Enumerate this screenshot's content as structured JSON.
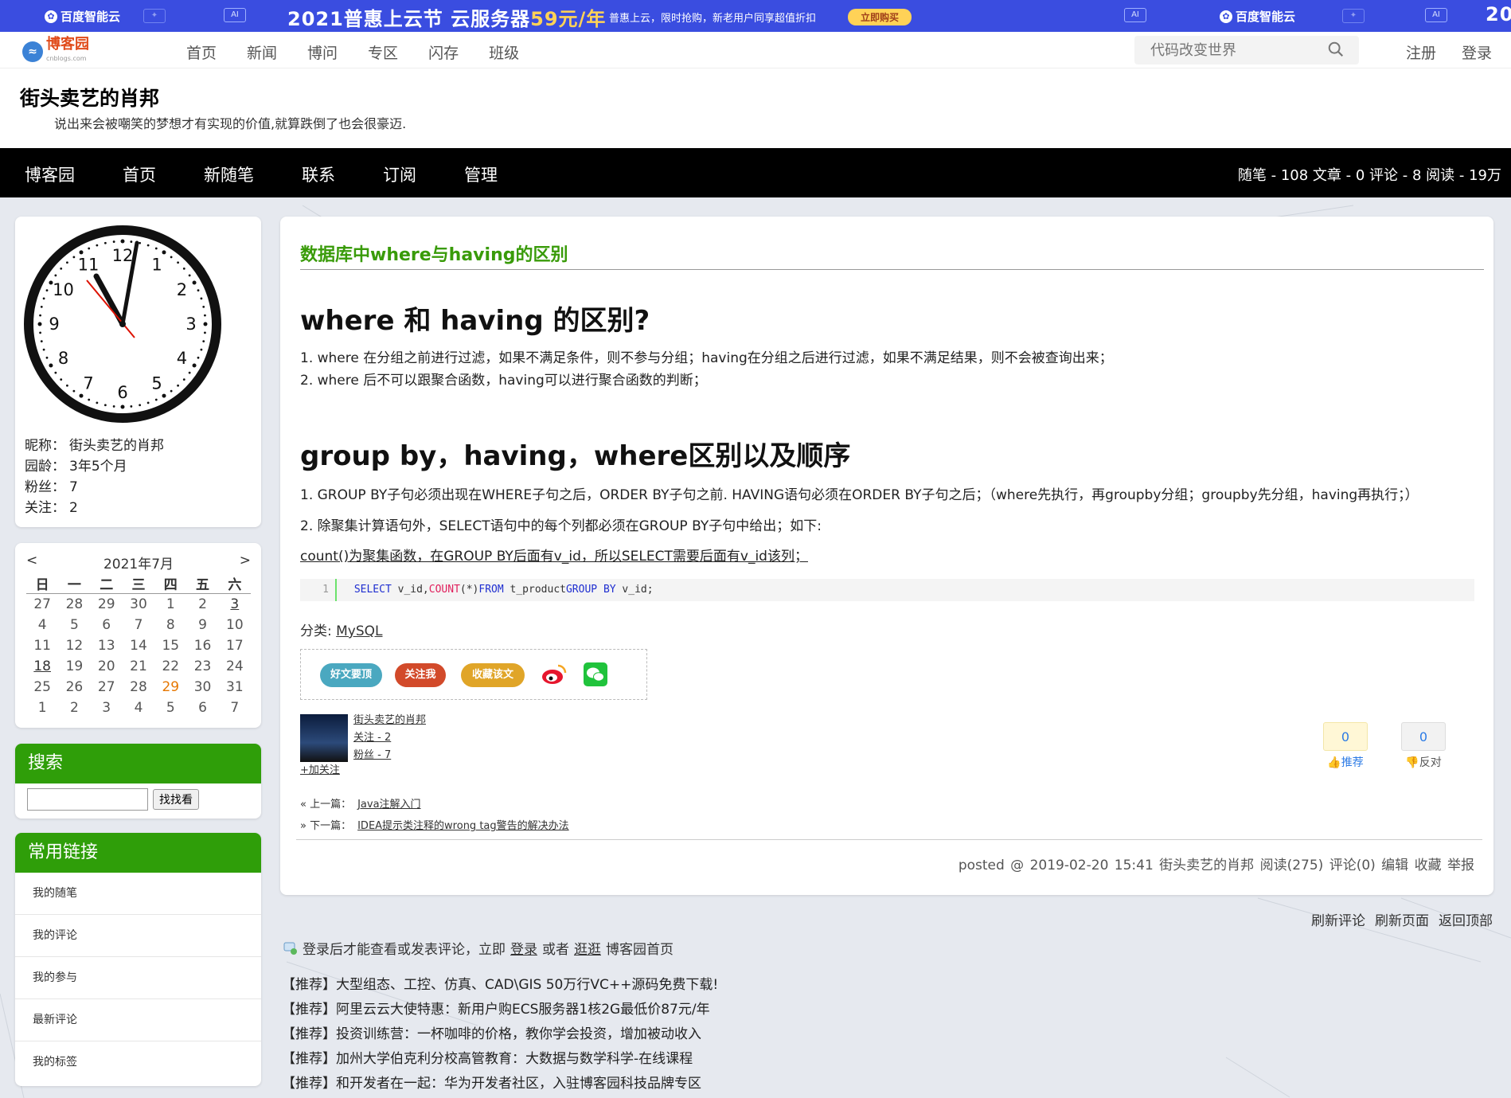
{
  "ad": {
    "brand": "百度智能云",
    "chip": "AI",
    "title": "2021普惠上云节  云服务器",
    "price": "59元/年",
    "sub": "普惠上云，限时抢购，新老用户同享超值折扣",
    "button": "立即购买",
    "tail": "20"
  },
  "site": {
    "logo_text": "博客园",
    "logo_sub": "cnblogs.com",
    "menu": [
      "首页",
      "新闻",
      "博问",
      "专区",
      "闪存",
      "班级"
    ],
    "search_placeholder": "代码改变世界",
    "auth": [
      "注册",
      "登录"
    ]
  },
  "blog": {
    "title": "街头卖艺的肖邦",
    "subtitle": "说出来会被嘲笑的梦想才有实现的价值,就算跌倒了也会很豪迈.",
    "nav": [
      "博客园",
      "首页",
      "新随笔",
      "联系",
      "订阅",
      "管理"
    ],
    "stats": "随笔 - 108  文章 - 0  评论 - 8  阅读 - 19万"
  },
  "profile": {
    "clock_numbers": [
      "12",
      "1",
      "2",
      "3",
      "4",
      "5",
      "6",
      "7",
      "8",
      "9",
      "10",
      "11"
    ],
    "rows": [
      {
        "k": "昵称：",
        "v": "街头卖艺的肖邦"
      },
      {
        "k": "园龄：",
        "v": "3年5个月"
      },
      {
        "k": "粉丝：",
        "v": "7"
      },
      {
        "k": "关注：",
        "v": "2"
      }
    ]
  },
  "calendar": {
    "prev": "<",
    "month": "2021年7月",
    "next": ">",
    "weekdays": [
      "日",
      "一",
      "二",
      "三",
      "四",
      "五",
      "六"
    ],
    "weeks": [
      [
        "27",
        "28",
        "29",
        "30",
        "1",
        "2",
        "3"
      ],
      [
        "4",
        "5",
        "6",
        "7",
        "8",
        "9",
        "10"
      ],
      [
        "11",
        "12",
        "13",
        "14",
        "15",
        "16",
        "17"
      ],
      [
        "18",
        "19",
        "20",
        "21",
        "22",
        "23",
        "24"
      ],
      [
        "25",
        "26",
        "27",
        "28",
        "29",
        "30",
        "31"
      ],
      [
        "1",
        "2",
        "3",
        "4",
        "5",
        "6",
        "7"
      ]
    ]
  },
  "search": {
    "title": "搜索",
    "button": "找找看"
  },
  "links": {
    "title": "常用链接",
    "items": [
      "我的随笔",
      "我的评论",
      "我的参与",
      "最新评论",
      "我的标签"
    ]
  },
  "post": {
    "title": "数据库中where与having的区别",
    "h1": "where 和 having 的区别?",
    "p1": "1. where 在分组之前进行过滤，如果不满足条件，则不参与分组；having在分组之后进行过滤，如果不满足结果，则不会被查询出来；",
    "p2": "2. where 后不可以跟聚合函数，having可以进行聚合函数的判断；",
    "h2": "group by，having，where区别以及顺序",
    "p3": "1. GROUP BY子句必须出现在WHERE子句之后，ORDER BY子句之前. HAVING语句必须在ORDER BY子句之后；（where先执行，再groupby分组；groupby先分组，having再执行；）",
    "p4": "2. 除聚集计算语句外，SELECT语句中的每个列都必须在GROUP BY子句中给出；如下:",
    "p5": "count()为聚集函数，在GROUP BY后面有v_id，所以SELECT需要后面有v_id该列；",
    "code_line": "1",
    "code": {
      "k1": "SELECT",
      "t1": " v_id,",
      "f1": "COUNT",
      "t2": "(*)",
      "k2": "FROM",
      "t3": " t_product",
      "k3": "GROUP BY",
      "t4": " v_id;"
    },
    "category_label": "分类: ",
    "category": "MySQL",
    "share": [
      "好文要顶",
      "关注我",
      "收藏该文"
    ],
    "author": {
      "name": "街头卖艺的肖邦",
      "follow_count": "关注 - 2",
      "fans": "粉丝 - 7",
      "add_follow": "+加关注"
    },
    "votes": {
      "up": "0",
      "up_label": "推荐",
      "down": "0",
      "down_label": "反对"
    },
    "prev_label": "« 上一篇：",
    "prev": "Java注解入门",
    "next_label": "» 下一篇：",
    "next": "IDEA提示类注释的wrong tag警告的解决办法",
    "footer": "posted @ 2019-02-20 15:41  街头卖艺的肖邦  阅读(275)  评论(0)  编辑  收藏  举报"
  },
  "below": {
    "links": [
      "刷新评论",
      "刷新页面",
      "返回顶部"
    ],
    "tip_pre": "登录后才能查看或发表评论，立即",
    "tip_login": "登录",
    "tip_or": "或者",
    "tip_stroll": "逛逛",
    "tip_post": "博客园首页",
    "recs": [
      "【推荐】大型组态、工控、仿真、CAD\\GIS 50万行VC++源码免费下载!",
      "【推荐】阿里云云大使特惠：新用户购ECS服务器1核2G最低价87元/年",
      "【推荐】投资训练营：一杯咖啡的价格，教你学会投资，增加被动收入",
      "【推荐】加州大学伯克利分校高管教育：大数据与数学科学-在线课程",
      "【推荐】和开发者在一起：华为开发者社区，入驻博客园科技品牌专区"
    ]
  },
  "colors": {
    "accent_green": "#2f9e09",
    "title_green": "#399b09",
    "ad_blue": "#3a4de0"
  }
}
